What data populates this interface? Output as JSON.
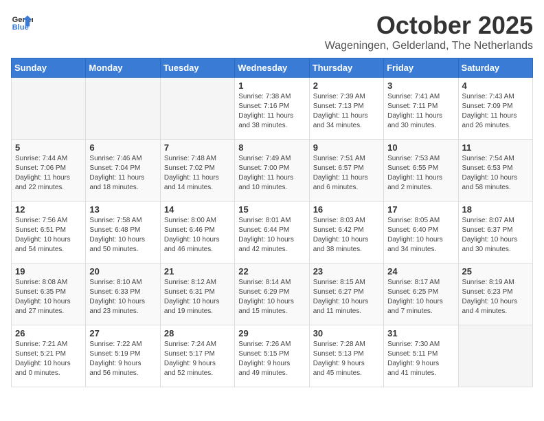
{
  "logo": {
    "general": "General",
    "blue": "Blue"
  },
  "title": {
    "month": "October 2025",
    "location": "Wageningen, Gelderland, The Netherlands"
  },
  "headers": [
    "Sunday",
    "Monday",
    "Tuesday",
    "Wednesday",
    "Thursday",
    "Friday",
    "Saturday"
  ],
  "weeks": [
    [
      {
        "day": "",
        "info": ""
      },
      {
        "day": "",
        "info": ""
      },
      {
        "day": "",
        "info": ""
      },
      {
        "day": "1",
        "info": "Sunrise: 7:38 AM\nSunset: 7:16 PM\nDaylight: 11 hours\nand 38 minutes."
      },
      {
        "day": "2",
        "info": "Sunrise: 7:39 AM\nSunset: 7:13 PM\nDaylight: 11 hours\nand 34 minutes."
      },
      {
        "day": "3",
        "info": "Sunrise: 7:41 AM\nSunset: 7:11 PM\nDaylight: 11 hours\nand 30 minutes."
      },
      {
        "day": "4",
        "info": "Sunrise: 7:43 AM\nSunset: 7:09 PM\nDaylight: 11 hours\nand 26 minutes."
      }
    ],
    [
      {
        "day": "5",
        "info": "Sunrise: 7:44 AM\nSunset: 7:06 PM\nDaylight: 11 hours\nand 22 minutes."
      },
      {
        "day": "6",
        "info": "Sunrise: 7:46 AM\nSunset: 7:04 PM\nDaylight: 11 hours\nand 18 minutes."
      },
      {
        "day": "7",
        "info": "Sunrise: 7:48 AM\nSunset: 7:02 PM\nDaylight: 11 hours\nand 14 minutes."
      },
      {
        "day": "8",
        "info": "Sunrise: 7:49 AM\nSunset: 7:00 PM\nDaylight: 11 hours\nand 10 minutes."
      },
      {
        "day": "9",
        "info": "Sunrise: 7:51 AM\nSunset: 6:57 PM\nDaylight: 11 hours\nand 6 minutes."
      },
      {
        "day": "10",
        "info": "Sunrise: 7:53 AM\nSunset: 6:55 PM\nDaylight: 11 hours\nand 2 minutes."
      },
      {
        "day": "11",
        "info": "Sunrise: 7:54 AM\nSunset: 6:53 PM\nDaylight: 10 hours\nand 58 minutes."
      }
    ],
    [
      {
        "day": "12",
        "info": "Sunrise: 7:56 AM\nSunset: 6:51 PM\nDaylight: 10 hours\nand 54 minutes."
      },
      {
        "day": "13",
        "info": "Sunrise: 7:58 AM\nSunset: 6:48 PM\nDaylight: 10 hours\nand 50 minutes."
      },
      {
        "day": "14",
        "info": "Sunrise: 8:00 AM\nSunset: 6:46 PM\nDaylight: 10 hours\nand 46 minutes."
      },
      {
        "day": "15",
        "info": "Sunrise: 8:01 AM\nSunset: 6:44 PM\nDaylight: 10 hours\nand 42 minutes."
      },
      {
        "day": "16",
        "info": "Sunrise: 8:03 AM\nSunset: 6:42 PM\nDaylight: 10 hours\nand 38 minutes."
      },
      {
        "day": "17",
        "info": "Sunrise: 8:05 AM\nSunset: 6:40 PM\nDaylight: 10 hours\nand 34 minutes."
      },
      {
        "day": "18",
        "info": "Sunrise: 8:07 AM\nSunset: 6:37 PM\nDaylight: 10 hours\nand 30 minutes."
      }
    ],
    [
      {
        "day": "19",
        "info": "Sunrise: 8:08 AM\nSunset: 6:35 PM\nDaylight: 10 hours\nand 27 minutes."
      },
      {
        "day": "20",
        "info": "Sunrise: 8:10 AM\nSunset: 6:33 PM\nDaylight: 10 hours\nand 23 minutes."
      },
      {
        "day": "21",
        "info": "Sunrise: 8:12 AM\nSunset: 6:31 PM\nDaylight: 10 hours\nand 19 minutes."
      },
      {
        "day": "22",
        "info": "Sunrise: 8:14 AM\nSunset: 6:29 PM\nDaylight: 10 hours\nand 15 minutes."
      },
      {
        "day": "23",
        "info": "Sunrise: 8:15 AM\nSunset: 6:27 PM\nDaylight: 10 hours\nand 11 minutes."
      },
      {
        "day": "24",
        "info": "Sunrise: 8:17 AM\nSunset: 6:25 PM\nDaylight: 10 hours\nand 7 minutes."
      },
      {
        "day": "25",
        "info": "Sunrise: 8:19 AM\nSunset: 6:23 PM\nDaylight: 10 hours\nand 4 minutes."
      }
    ],
    [
      {
        "day": "26",
        "info": "Sunrise: 7:21 AM\nSunset: 5:21 PM\nDaylight: 10 hours\nand 0 minutes."
      },
      {
        "day": "27",
        "info": "Sunrise: 7:22 AM\nSunset: 5:19 PM\nDaylight: 9 hours\nand 56 minutes."
      },
      {
        "day": "28",
        "info": "Sunrise: 7:24 AM\nSunset: 5:17 PM\nDaylight: 9 hours\nand 52 minutes."
      },
      {
        "day": "29",
        "info": "Sunrise: 7:26 AM\nSunset: 5:15 PM\nDaylight: 9 hours\nand 49 minutes."
      },
      {
        "day": "30",
        "info": "Sunrise: 7:28 AM\nSunset: 5:13 PM\nDaylight: 9 hours\nand 45 minutes."
      },
      {
        "day": "31",
        "info": "Sunrise: 7:30 AM\nSunset: 5:11 PM\nDaylight: 9 hours\nand 41 minutes."
      },
      {
        "day": "",
        "info": ""
      }
    ]
  ]
}
